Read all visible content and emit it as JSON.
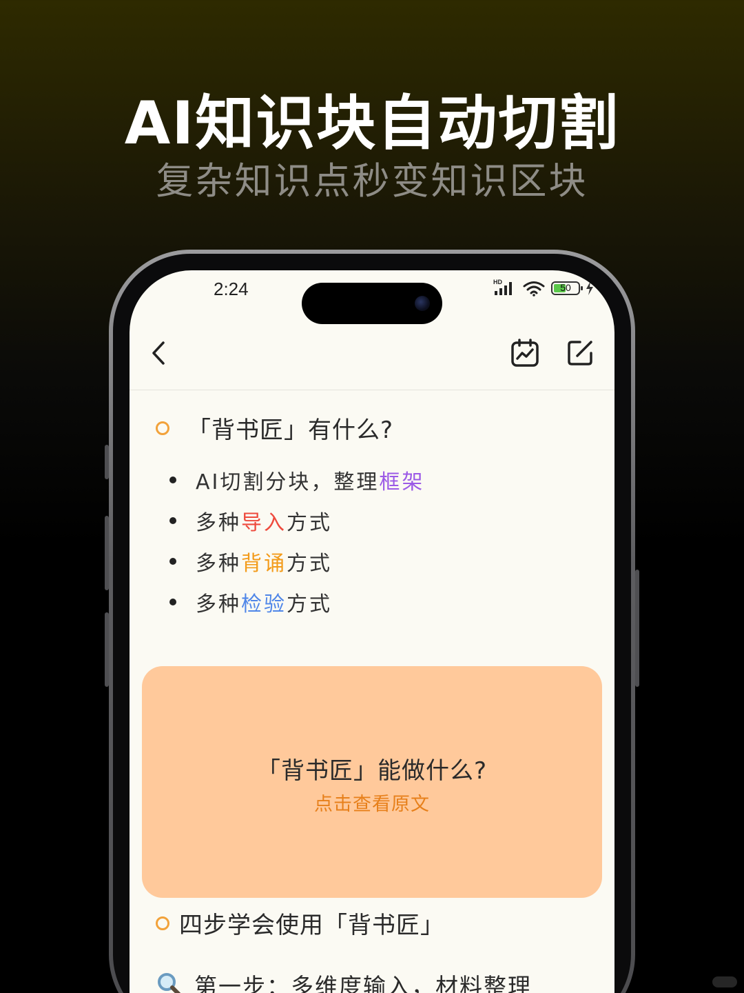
{
  "promo": {
    "headline": "AI知识块自动切割",
    "subheadline": "复杂知识点秒变知识区块"
  },
  "status_bar": {
    "time": "2:24",
    "network_label": "HD",
    "battery_level": "50"
  },
  "navbar": {
    "back_icon": "chevron-left-icon",
    "chart_icon": "calendar-chart-icon",
    "edit_icon": "edit-icon"
  },
  "section1": {
    "heading": "「背书匠」有什么?",
    "items": [
      {
        "pre": "AI切割分块，整理",
        "highlight": "框架",
        "post": ""
      },
      {
        "pre": "多种",
        "highlight": "导入",
        "post": "方式"
      },
      {
        "pre": "多种",
        "highlight": "背诵",
        "post": "方式"
      },
      {
        "pre": "多种",
        "highlight": "检验",
        "post": "方式"
      }
    ]
  },
  "card": {
    "title": "「背书匠」能做什么?",
    "link": "点击查看原文"
  },
  "section2": {
    "heading": "四步学会使用「背书匠」",
    "step1_icon": "magnifier-icon",
    "step1": "第一步：多维度输入，材料整理"
  },
  "colors": {
    "accent_orange": "#f2a23a",
    "card_bg": "#ffc99b",
    "highlight_purple": "#9b59e6",
    "highlight_red": "#ee4a3d",
    "highlight_orange": "#f39b1a",
    "highlight_blue": "#4f86e8"
  }
}
